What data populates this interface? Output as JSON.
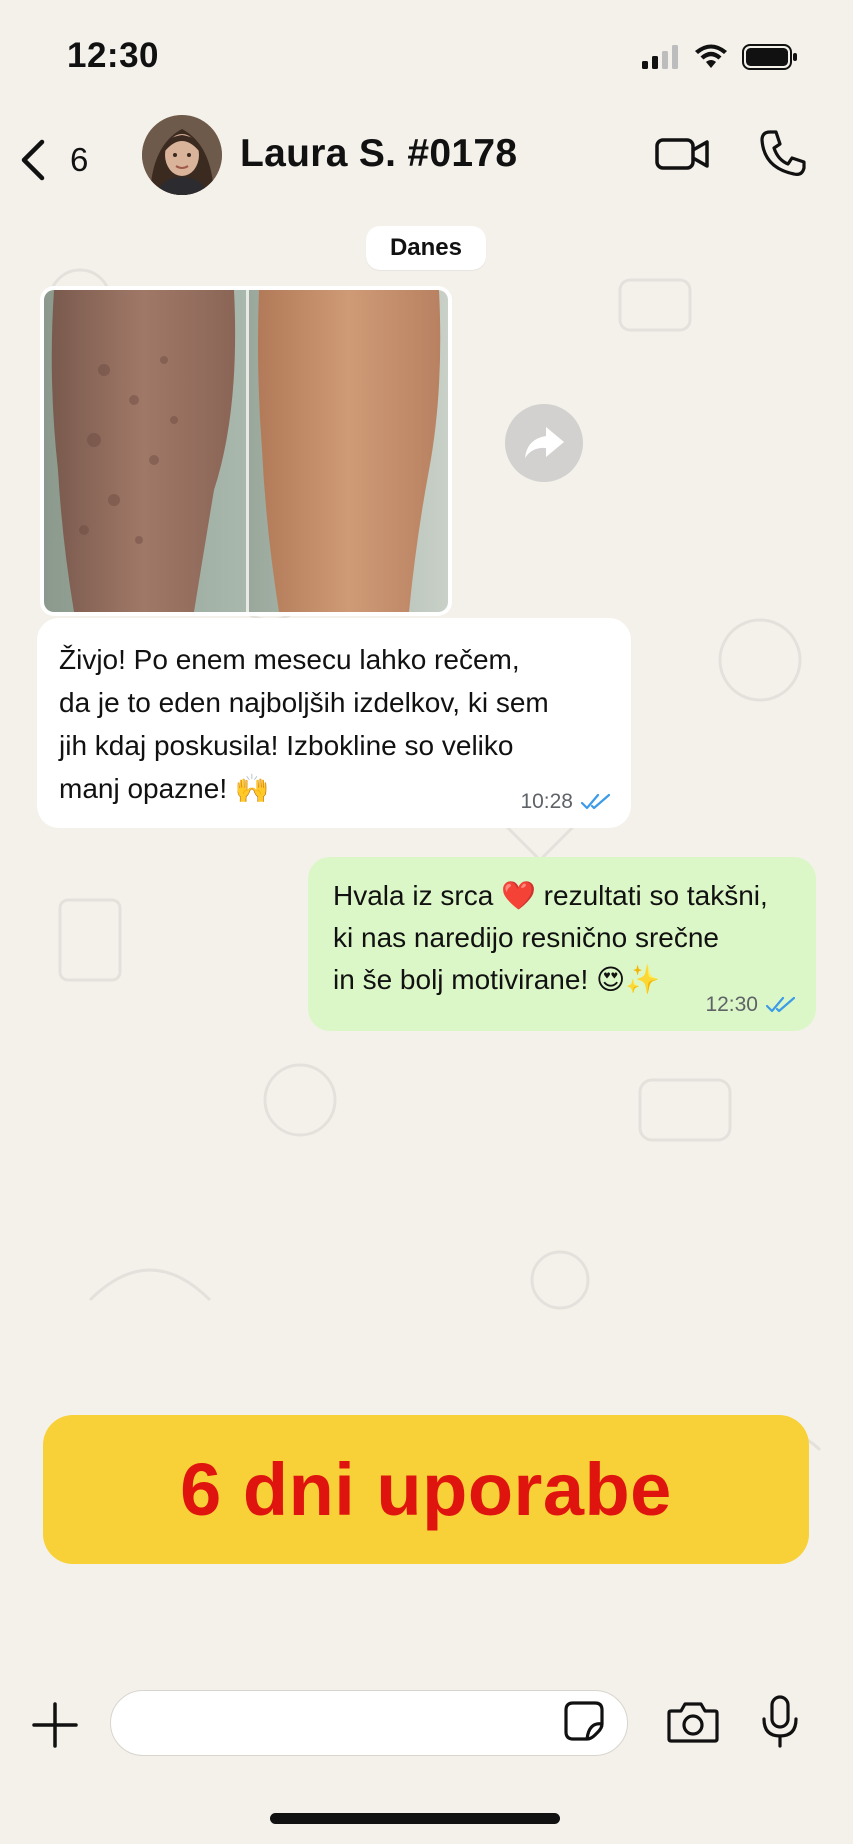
{
  "status_bar": {
    "time": "12:30"
  },
  "header": {
    "back_count": "6",
    "contact_name": "Laura S. #0178"
  },
  "date_chip": "Danes",
  "messages": [
    {
      "direction": "incoming",
      "lines": [
        "Živjo! Po enem mesecu lahko rečem,",
        "da je to eden najboljših izdelkov, ki sem",
        "jih kdaj poskusila! Izbokline so veliko",
        "manj opazne! 🙌"
      ],
      "time": "10:28"
    },
    {
      "direction": "outgoing",
      "lines": [
        "Hvala iz srca ❤️ rezultati so takšni,",
        "ki nas naredijo resnično srečne",
        "in še bolj motivirane! 😍✨"
      ],
      "time": "12:30"
    }
  ],
  "banner": {
    "text": "6 dni uporabe"
  },
  "colors": {
    "background": "#f4f1eb",
    "outgoing_bubble": "#dcf7c7",
    "incoming_bubble": "#ffffff",
    "read_ticks": "#3c9be8",
    "banner_bg": "#f8d038",
    "banner_text": "#e0140f"
  },
  "icons": [
    "back-chevron-icon",
    "video-camera-icon",
    "phone-icon",
    "forward-icon",
    "double-check-icon",
    "plus-icon",
    "sticker-icon",
    "camera-icon",
    "microphone-icon",
    "signal-icon",
    "wifi-icon",
    "battery-icon"
  ]
}
